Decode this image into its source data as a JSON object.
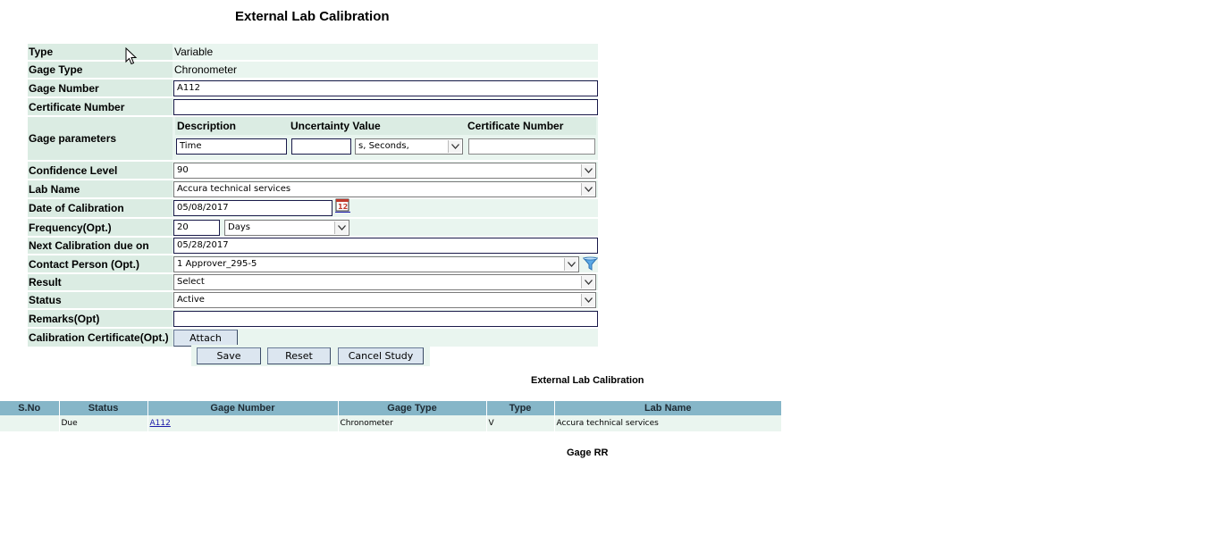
{
  "page": {
    "title": "External Lab Calibration"
  },
  "form": {
    "type": {
      "label": "Type",
      "value": "Variable"
    },
    "gage_type": {
      "label": "Gage Type",
      "value": "Chronometer"
    },
    "gage_number": {
      "label": "Gage Number",
      "value": "A112"
    },
    "certificate_number": {
      "label": "Certificate Number",
      "value": ""
    },
    "gage_parameters": {
      "label": "Gage parameters",
      "headers": {
        "description": "Description",
        "uncertainty": "Uncertainty Value",
        "certificate": "Certificate Number"
      },
      "description_value": "Time",
      "uncertainty_value": "",
      "unit_value": "s, Seconds,",
      "certificate_value": ""
    },
    "confidence_level": {
      "label": "Confidence Level",
      "value": "90"
    },
    "lab_name": {
      "label": "Lab Name",
      "value": "Accura technical services"
    },
    "date_of_calibration": {
      "label": "Date of Calibration",
      "value": "05/08/2017"
    },
    "frequency": {
      "label": "Frequency(Opt.)",
      "value": "20",
      "unit": "Days"
    },
    "next_due": {
      "label": "Next Calibration due on",
      "value": "05/28/2017"
    },
    "contact_person": {
      "label": "Contact Person (Opt.)",
      "value": "1 Approver_295-5"
    },
    "result": {
      "label": "Result",
      "value": "Select"
    },
    "status": {
      "label": "Status",
      "value": "Active"
    },
    "remarks": {
      "label": "Remarks(Opt)",
      "value": ""
    },
    "certificate_attach": {
      "label": "Calibration Certificate(Opt.)",
      "button": "Attach"
    }
  },
  "buttons": {
    "save": "Save",
    "reset": "Reset",
    "cancel": "Cancel Study"
  },
  "table": {
    "title": "External Lab Calibration",
    "columns": [
      "S.No",
      "Status",
      "Gage Number",
      "Gage Type",
      "Type",
      "Lab Name"
    ],
    "rows": [
      {
        "sno": "",
        "status": "Due",
        "gage_number": "A112",
        "gage_type": "Chronometer",
        "type": "V",
        "lab_name": "Accura technical services"
      }
    ]
  },
  "gage_rr": {
    "title": "Gage RR"
  },
  "icons": {
    "calendar": "calendar-icon",
    "filter": "filter-icon",
    "dropdown": "chevron-down-icon",
    "cursor": "mouse-pointer-icon"
  },
  "colors": {
    "label_bg": "#dbece3",
    "row_bg": "#e9f5ef",
    "table_header": "#86b6c8",
    "button_bg": "#dce6f0"
  }
}
